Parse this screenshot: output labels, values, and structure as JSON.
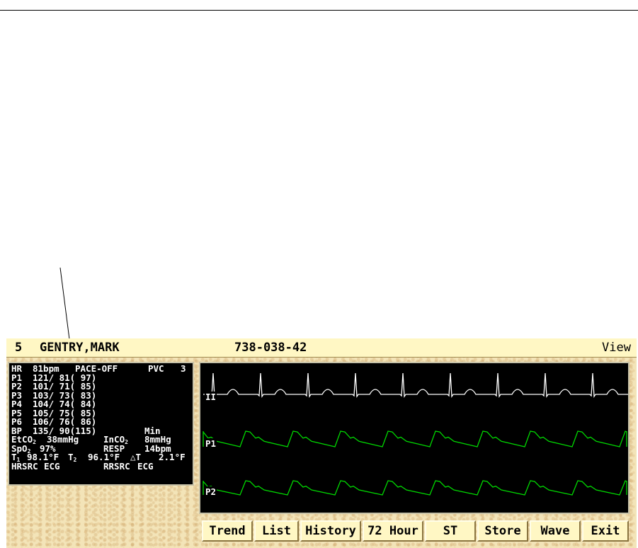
{
  "header": {
    "bed": "5",
    "patient_name": "GENTRY,MARK",
    "mrn": "738-038-42",
    "view_label": "View"
  },
  "params": {
    "hr_row": {
      "label": "HR",
      "value": "81bpm",
      "pace": "PACE-OFF",
      "pvc_label": "PVC",
      "pvc_value": "3"
    },
    "pressures": [
      {
        "label": "P1",
        "value": "121/ 81( 97)"
      },
      {
        "label": "P2",
        "value": "101/ 71( 85)"
      },
      {
        "label": "P3",
        "value": "103/ 73( 83)"
      },
      {
        "label": "P4",
        "value": "104/ 74( 84)"
      },
      {
        "label": "P5",
        "value": "105/ 75( 85)"
      },
      {
        "label": "P6",
        "value": "106/ 76( 86)"
      }
    ],
    "bp_row": {
      "label": "BP",
      "value": "135/ 90(115)",
      "mode": "Min"
    },
    "co2_row": {
      "etco2_label": "EtCO",
      "etco2_sub": "2",
      "etco2_value": "38mmHg",
      "inco2_label": "InCO",
      "inco2_sub": "2",
      "inco2_value": "8mmHg"
    },
    "spo2_row": {
      "spo2_label": "SpO",
      "spo2_sub": "2",
      "spo2_value": "97%",
      "resp_label": "RESP",
      "resp_value": "14bpm"
    },
    "temp_row": {
      "t1_label": "T",
      "t1_sub": "1",
      "t1_value": "98.1°F",
      "t2_label": "T",
      "t2_sub": "2",
      "t2_value": "96.1°F",
      "dt_label": "△T",
      "dt_value": "2.1°F"
    },
    "src_row": {
      "hrsrc_label": "HRSRC",
      "hrsrc_value": "ECG",
      "rrsrc_label": "RRSRC",
      "rrsrc_value": "ECG"
    }
  },
  "waveforms": {
    "leads": [
      {
        "label": "II",
        "color": "#ffffff"
      },
      {
        "label": "P1",
        "color": "#00d800"
      },
      {
        "label": "P2",
        "color": "#00d800"
      }
    ]
  },
  "buttons": [
    "Trend",
    "List",
    "History",
    "72 Hour",
    "ST",
    "Store",
    "Wave",
    "Exit"
  ],
  "colors": {
    "panel_bg": "#fff7c4",
    "screen_bg": "#000000",
    "ecg": "#ffffff",
    "pressure": "#00d800"
  }
}
